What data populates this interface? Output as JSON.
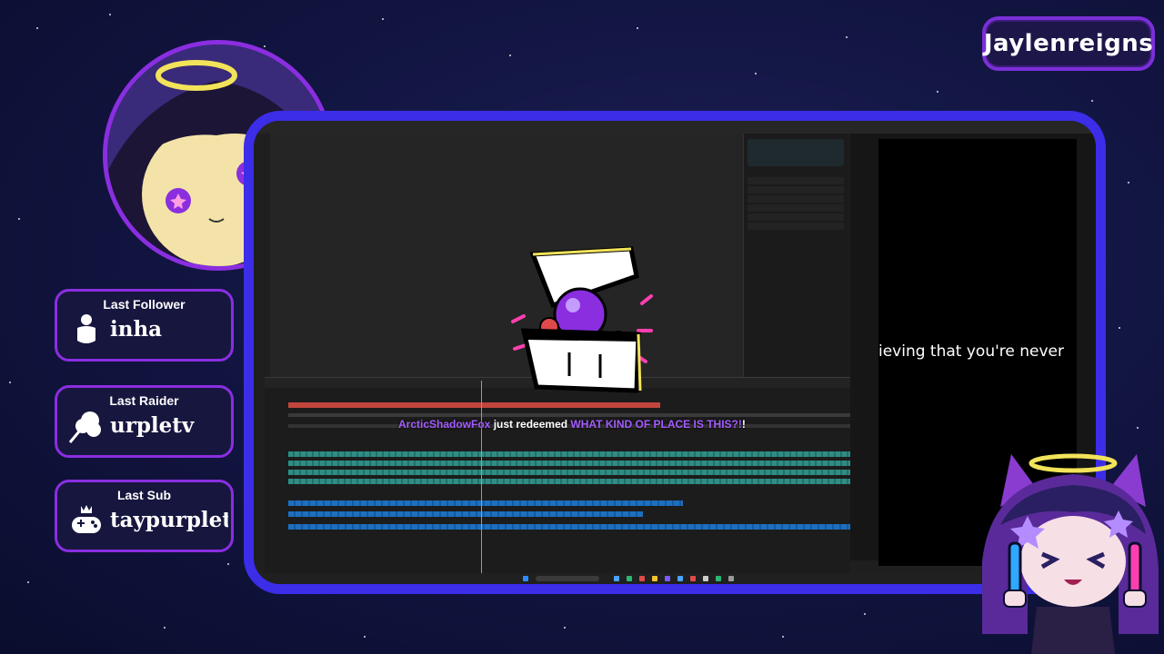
{
  "streamer": {
    "name": "Jaylenreigns"
  },
  "stats": [
    {
      "title": "Last Follower",
      "value": "inha",
      "icon": "person-icon"
    },
    {
      "title": "Last Raider",
      "value": "urpletv",
      "icon": "raid-icon"
    },
    {
      "title": "Last Sub",
      "value": "taypurplet",
      "icon": "crowned-gamepad-icon"
    }
  ],
  "editor": {
    "caption": "ieving that you're never"
  },
  "redeem": {
    "user": "ArcticShadowFox",
    "middle": "just redeemed",
    "reward": "WHAT KIND OF PLACE IS THIS?!",
    "tail": "!"
  },
  "colors": {
    "accent_purple": "#8a2ee0",
    "frame_blue": "#3b2de8",
    "background_navy": "#11143f"
  }
}
